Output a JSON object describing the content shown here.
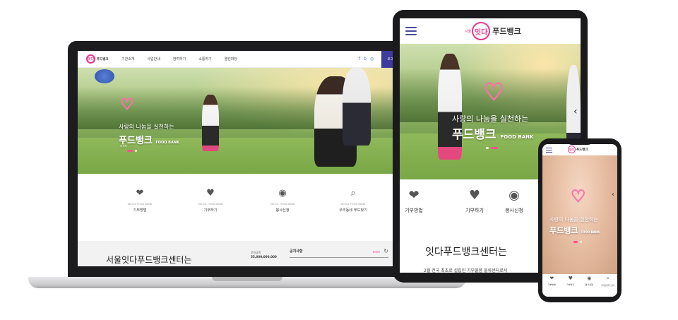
{
  "brand": {
    "prefix": "서울",
    "mark": "잇다",
    "name": "푸드뱅크"
  },
  "laptop": {
    "logo_small": "푸드뱅크",
    "nav": [
      "기관소개",
      "사업안내",
      "참여하기",
      "소통하기",
      "열린마당"
    ],
    "social": {
      "facebook": "f",
      "blog": "b",
      "instagram": "◎"
    },
    "login": "로그인  |  회원가입",
    "hero": {
      "subtitle": "사랑의 나눔을 실천하는",
      "title": "푸드뱅크",
      "title_en": "FOOD BANK",
      "more": "자세히"
    },
    "services": [
      {
        "en": "SEOUL FOOD BANK",
        "label": "기부방법",
        "icon": "hand-heart-icon"
      },
      {
        "en": "SEOUL FOOD BANK",
        "label": "기부하기",
        "icon": "heart-hands-icon"
      },
      {
        "en": "SEOUL FOOD BANK",
        "label": "봉사신청",
        "icon": "medal-icon"
      },
      {
        "en": "SEOUL FOOD BANK",
        "label": "우리동네 푸드찾기",
        "icon": "magnifier-icon"
      }
    ],
    "about_title": "서울잇다푸드뱅크센터는",
    "fund_label": "후원금액",
    "fund_value": "55,000,000,000",
    "notice_label": "공지사항",
    "notice_more": "more"
  },
  "tablet": {
    "hero": {
      "subtitle": "사랑의 나눔을 실천하는",
      "title": "푸드뱅크",
      "title_en": "FOOD BANK"
    },
    "services": [
      "기부방법",
      "기부하기",
      "봉사신청"
    ],
    "about_title": "잇다푸드뱅크센터는",
    "about_text": "2월 전국 최초로 설립된 기부물품 물류센터로서"
  },
  "phone": {
    "hero": {
      "subtitle": "사랑의 나눔을 실천하는",
      "title": "푸드뱅크",
      "title_en": "FOOD BANK"
    },
    "services": [
      "기부방법",
      "기부하기",
      "봉사신청",
      "우리동네푸드찾기"
    ]
  },
  "colors": {
    "accent": "#e6398b",
    "nav": "#3d3b9e"
  }
}
